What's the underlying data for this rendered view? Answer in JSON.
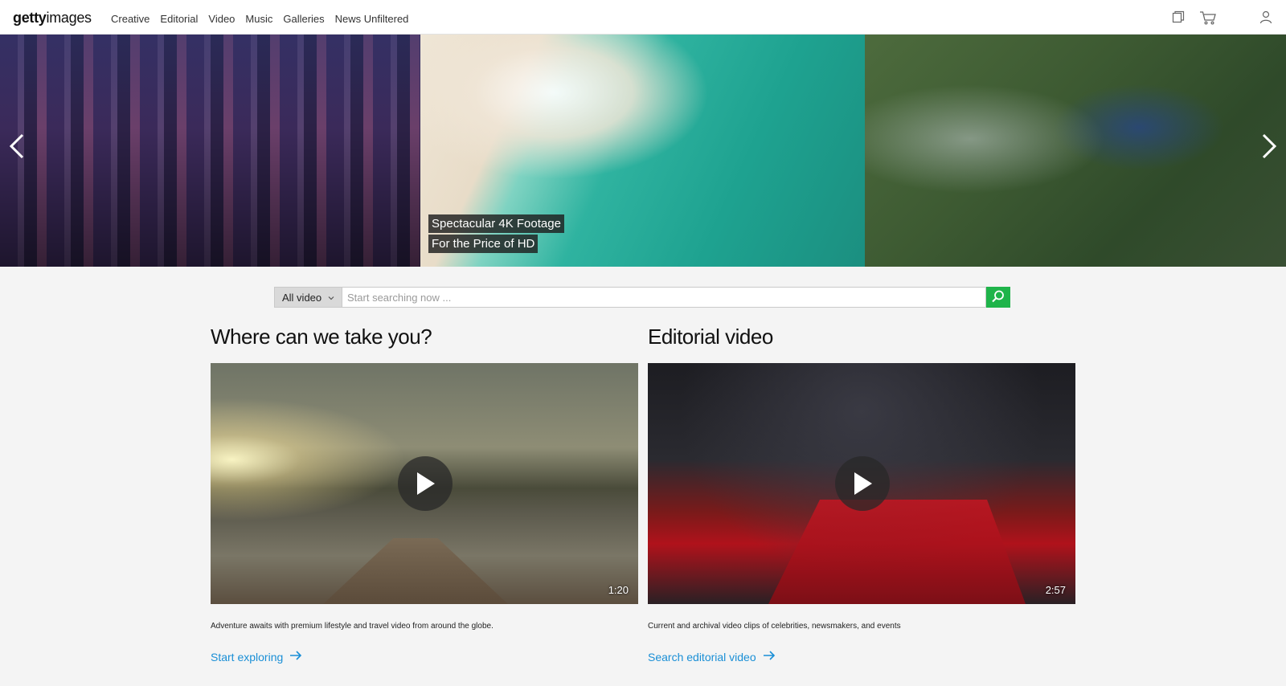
{
  "header": {
    "logo": {
      "part1": "getty",
      "part2": "images"
    },
    "nav": [
      "Creative",
      "Editorial",
      "Video",
      "Music",
      "Galleries",
      "News Unfiltered"
    ],
    "icons": [
      "boards-icon",
      "cart-icon",
      "account-icon"
    ]
  },
  "hero": {
    "caption_line1": "Spectacular 4K Footage",
    "caption_line2": "For the Price of HD"
  },
  "search": {
    "filter_selected": "All video",
    "placeholder": "Start searching now ...",
    "accent": "#1fb44a"
  },
  "sections": [
    {
      "title": "Where can we take you?",
      "duration": "1:20",
      "description": "Adventure awaits with premium lifestyle and travel video from around the globe.",
      "cta": "Start exploring"
    },
    {
      "title": "Editorial video",
      "duration": "2:57",
      "description": "Current and archival video clips of celebrities, newsmakers, and events",
      "cta": "Search editorial video"
    }
  ],
  "colors": {
    "link": "#1a8fd6",
    "background": "#f4f4f4"
  }
}
